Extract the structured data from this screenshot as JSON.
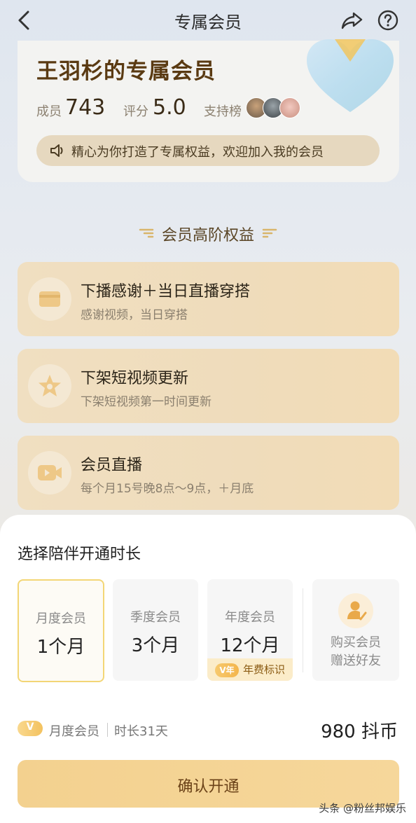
{
  "header": {
    "title": "专属会员"
  },
  "profile": {
    "title": "王羽杉的专属会员",
    "members_label": "成员",
    "members_value": "743",
    "rating_label": "评分",
    "rating_value": "5.0",
    "support_label": "支持榜",
    "notice": "精心为你打造了专属权益，欢迎加入我的会员"
  },
  "benefits_section": {
    "title": "会员高阶权益"
  },
  "benefits": [
    {
      "title": "下播感谢＋当日直播穿搭",
      "subtitle": "感谢视频，当日穿搭",
      "icon": "card-icon"
    },
    {
      "title": "下架短视频更新",
      "subtitle": "下架短视频第一时间更新",
      "icon": "star-icon"
    },
    {
      "title": "会员直播",
      "subtitle": "每个月15号晚8点～9点，＋月底",
      "icon": "video-icon"
    }
  ],
  "sheet": {
    "title": "选择陪伴开通时长",
    "plans": [
      {
        "name": "月度会员",
        "duration": "1个月",
        "selected": true
      },
      {
        "name": "季度会员",
        "duration": "3个月",
        "selected": false
      },
      {
        "name": "年度会员",
        "duration": "12个月",
        "selected": false,
        "badge_icon": "V年",
        "badge_text": "年费标识"
      }
    ],
    "gift": {
      "line1": "购买会员",
      "line2": "赠送好友"
    },
    "summary": {
      "tag": "V",
      "plan_name": "月度会员",
      "duration_text": "时长31天",
      "price": "980 抖币"
    },
    "confirm_label": "确认开通"
  },
  "watermark": "头条 @粉丝邦娱乐",
  "colors": {
    "accent": "#f3d18f",
    "selected_border": "#f3d676",
    "brand_brown": "#5a3a12"
  }
}
